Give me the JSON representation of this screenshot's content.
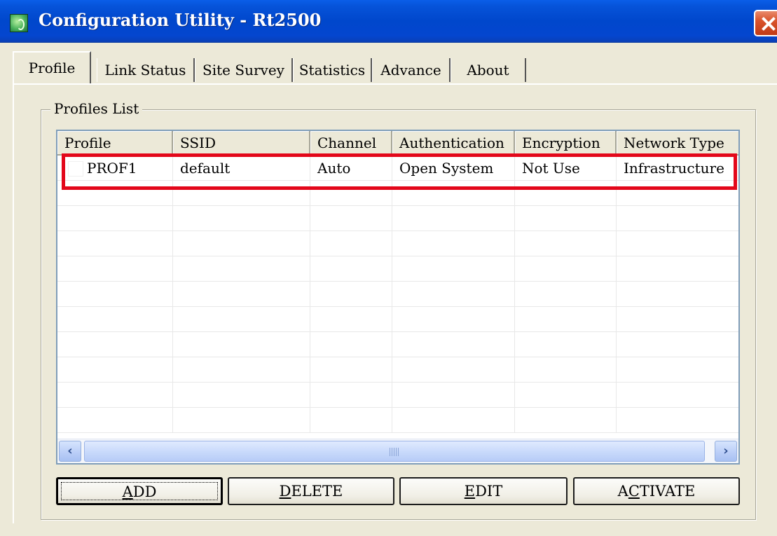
{
  "window": {
    "title": "Configuration Utility - Rt2500"
  },
  "tabs": [
    {
      "label": "Profile",
      "active": true
    },
    {
      "label": "Link Status",
      "active": false
    },
    {
      "label": "Site Survey",
      "active": false
    },
    {
      "label": "Statistics",
      "active": false
    },
    {
      "label": "Advance",
      "active": false
    },
    {
      "label": "About",
      "active": false
    }
  ],
  "profiles": {
    "group_label": "Profiles List",
    "columns": [
      "Profile",
      "SSID",
      "Channel",
      "Authentication",
      "Encryption",
      "Network Type"
    ],
    "rows": [
      {
        "profile": "PROF1",
        "ssid": "default",
        "channel": "Auto",
        "authentication": "Open System",
        "encryption": "Not Use",
        "network_type": "Infrastructure"
      }
    ]
  },
  "buttons": {
    "add": {
      "mnemonic": "A",
      "rest": "DD"
    },
    "delete": {
      "mnemonic": "D",
      "rest": "ELETE"
    },
    "edit": {
      "mnemonic": "E",
      "rest": "DIT"
    },
    "activate": {
      "prefix": "A",
      "mnemonic": "C",
      "rest": "TIVATE"
    }
  },
  "colors": {
    "titlebar": "#0047cc",
    "highlight": "#e3071a",
    "dialog_bg": "#ece9d8"
  },
  "icons": {
    "app": "app-icon",
    "close": "close-icon",
    "scroll_left": "arrow-left-icon",
    "scroll_right": "arrow-right-icon"
  }
}
